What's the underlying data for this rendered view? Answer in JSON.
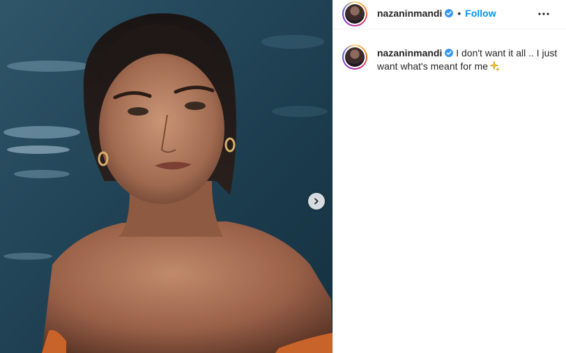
{
  "post": {
    "username": "nazaninmandi",
    "separator": "•",
    "follow_label": "Follow",
    "caption_text": "I don't want it all .. I just want what's meant for me",
    "icons": {
      "verified": "verified-badge-icon",
      "more": "more-options-icon",
      "next": "chevron-right-icon",
      "sparkle": "sparkles-emoji"
    },
    "colors": {
      "accent": "#0095f6",
      "verified": "#3897f0",
      "text": "#262626"
    }
  }
}
